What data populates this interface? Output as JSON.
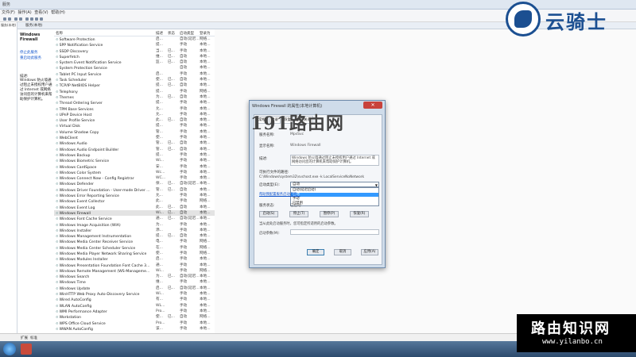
{
  "window": {
    "title": "服务"
  },
  "menu": [
    "文件(F)",
    "操作(A)",
    "查看(V)",
    "帮助(H)"
  ],
  "nav": [
    "服务(本地)"
  ],
  "header_tab": "服务(本地)",
  "desc": {
    "name": "Windows Firewall",
    "stop_link": "停止此服务",
    "restart_link": "重启动此服务",
    "label": "描述:",
    "text": "Windows 防火墙通过阻止未授权用户通过 Internet 或网络访问您的计算机来帮助保护计算机。"
  },
  "columns": {
    "name": "名称",
    "desc": "描述",
    "status": "状态",
    "startup": "启动类型",
    "logon": "登录为"
  },
  "services": [
    {
      "name": "Software Protection",
      "desc": "启...",
      "status": "",
      "startup": "自动(延迟...",
      "logon": "网络..."
    },
    {
      "name": "SPP Notification Service",
      "desc": "提...",
      "status": "",
      "startup": "手动",
      "logon": "本地..."
    },
    {
      "name": "SSDP Discovery",
      "desc": "当...",
      "status": "已...",
      "startup": "手动",
      "logon": "本地..."
    },
    {
      "name": "Superfetch",
      "desc": "维...",
      "status": "已...",
      "startup": "自动",
      "logon": "本地..."
    },
    {
      "name": "System Event Notification Service",
      "desc": "监...",
      "status": "已...",
      "startup": "自动",
      "logon": "本地..."
    },
    {
      "name": "System Protection Service",
      "desc": "",
      "status": "",
      "startup": "自动",
      "logon": "本地..."
    },
    {
      "name": "Tablet PC Input Service",
      "desc": "启...",
      "status": "",
      "startup": "手动",
      "logon": "本地..."
    },
    {
      "name": "Task Scheduler",
      "desc": "使...",
      "status": "已...",
      "startup": "自动",
      "logon": "本地..."
    },
    {
      "name": "TCP/IP NetBIOS Helper",
      "desc": "提...",
      "status": "已...",
      "startup": "自动",
      "logon": "本地..."
    },
    {
      "name": "Telephony",
      "desc": "提...",
      "status": "",
      "startup": "手动",
      "logon": "网络..."
    },
    {
      "name": "Themes",
      "desc": "为...",
      "status": "已...",
      "startup": "自动",
      "logon": "本地..."
    },
    {
      "name": "Thread Ordering Server",
      "desc": "提...",
      "status": "",
      "startup": "手动",
      "logon": "本地..."
    },
    {
      "name": "TPM Base Services",
      "desc": "允...",
      "status": "",
      "startup": "手动",
      "logon": "本地..."
    },
    {
      "name": "UPnP Device Host",
      "desc": "允...",
      "status": "",
      "startup": "手动",
      "logon": "本地..."
    },
    {
      "name": "User Profile Service",
      "desc": "此...",
      "status": "已...",
      "startup": "自动",
      "logon": "本地..."
    },
    {
      "name": "Virtual Disk",
      "desc": "提...",
      "status": "",
      "startup": "手动",
      "logon": "本地..."
    },
    {
      "name": "Volume Shadow Copy",
      "desc": "管...",
      "status": "",
      "startup": "手动",
      "logon": "本地..."
    },
    {
      "name": "WebClient",
      "desc": "使...",
      "status": "",
      "startup": "手动",
      "logon": "本地..."
    },
    {
      "name": "Windows Audio",
      "desc": "管...",
      "status": "已...",
      "startup": "自动",
      "logon": "本地..."
    },
    {
      "name": "Windows Audio Endpoint Builder",
      "desc": "管...",
      "status": "已...",
      "startup": "自动",
      "logon": "本地..."
    },
    {
      "name": "Windows Backup",
      "desc": "提...",
      "status": "",
      "startup": "手动",
      "logon": "本地..."
    },
    {
      "name": "Windows Biometric Service",
      "desc": "Wi...",
      "status": "",
      "startup": "手动",
      "logon": "本地..."
    },
    {
      "name": "Windows CardSpace",
      "desc": "安...",
      "status": "",
      "startup": "手动",
      "logon": "本地..."
    },
    {
      "name": "Windows Color System",
      "desc": "Wc...",
      "status": "",
      "startup": "手动",
      "logon": "本地..."
    },
    {
      "name": "Windows Connect Now - Config Registrar",
      "desc": "WC...",
      "status": "",
      "startup": "手动",
      "logon": "本地..."
    },
    {
      "name": "Windows Defender",
      "desc": "保...",
      "status": "已...",
      "startup": "自动(延迟...",
      "logon": "本地..."
    },
    {
      "name": "Windows Driver Foundation - User-mode Driver ...",
      "desc": "管...",
      "status": "已...",
      "startup": "自动",
      "logon": "本地..."
    },
    {
      "name": "Windows Error Reporting Service",
      "desc": "允...",
      "status": "",
      "startup": "手动",
      "logon": "本地..."
    },
    {
      "name": "Windows Event Collector",
      "desc": "此...",
      "status": "",
      "startup": "手动",
      "logon": "网络..."
    },
    {
      "name": "Windows Event Log",
      "desc": "此...",
      "status": "已...",
      "startup": "自动",
      "logon": "本地..."
    },
    {
      "name": "Windows Firewall",
      "desc": "Wi...",
      "status": "已...",
      "startup": "自动",
      "logon": "本地..."
    },
    {
      "name": "Windows Font Cache Service",
      "desc": "通...",
      "status": "已...",
      "startup": "自动(延迟...",
      "logon": "本地..."
    },
    {
      "name": "Windows Image Acquisition (WIA)",
      "desc": "为...",
      "status": "",
      "startup": "手动",
      "logon": "本地..."
    },
    {
      "name": "Windows Installer",
      "desc": "添...",
      "status": "",
      "startup": "手动",
      "logon": "本地..."
    },
    {
      "name": "Windows Management Instrumentation",
      "desc": "提...",
      "status": "已...",
      "startup": "自动",
      "logon": "本地..."
    },
    {
      "name": "Windows Media Center Receiver Service",
      "desc": "电...",
      "status": "",
      "startup": "手动",
      "logon": "网络..."
    },
    {
      "name": "Windows Media Center Scheduler Service",
      "desc": "在...",
      "status": "",
      "startup": "手动",
      "logon": "网络..."
    },
    {
      "name": "Windows Media Player Network Sharing Service",
      "desc": "使...",
      "status": "",
      "startup": "手动",
      "logon": "网络..."
    },
    {
      "name": "Windows Modules Installer",
      "desc": "启...",
      "status": "",
      "startup": "手动",
      "logon": "本地..."
    },
    {
      "name": "Windows Presentation Foundation Font Cache 3...",
      "desc": "通...",
      "status": "",
      "startup": "手动",
      "logon": "本地..."
    },
    {
      "name": "Windows Remote Management (WS-Manageme...",
      "desc": "Wi...",
      "status": "",
      "startup": "手动",
      "logon": "网络..."
    },
    {
      "name": "Windows Search",
      "desc": "为...",
      "status": "已...",
      "startup": "自动(延迟...",
      "logon": "本地..."
    },
    {
      "name": "Windows Time",
      "desc": "维...",
      "status": "",
      "startup": "手动",
      "logon": "本地..."
    },
    {
      "name": "Windows Update",
      "desc": "启...",
      "status": "已...",
      "startup": "自动(延迟...",
      "logon": "本地..."
    },
    {
      "name": "WinHTTP Web Proxy Auto-Discovery Service",
      "desc": "Wi...",
      "status": "",
      "startup": "手动",
      "logon": "本地..."
    },
    {
      "name": "Wired AutoConfig",
      "desc": "有...",
      "status": "",
      "startup": "手动",
      "logon": "本地..."
    },
    {
      "name": "WLAN AutoConfig",
      "desc": "WL...",
      "status": "",
      "startup": "手动",
      "logon": "本地..."
    },
    {
      "name": "WMI Performance Adapter",
      "desc": "Pro...",
      "status": "",
      "startup": "手动",
      "logon": "本地..."
    },
    {
      "name": "Workstation",
      "desc": "使...",
      "status": "已...",
      "startup": "自动",
      "logon": "网络..."
    },
    {
      "name": "WPS Office Cloud Service",
      "desc": "Pro...",
      "status": "",
      "startup": "手动",
      "logon": "本地..."
    },
    {
      "name": "WWAN AutoConfig",
      "desc": "该...",
      "status": "",
      "startup": "手动",
      "logon": "本地..."
    }
  ],
  "selected_index": 30,
  "statusbar": {
    "tab1": "扩展",
    "tab2": "标准"
  },
  "dialog": {
    "title": "Windows Firewall 的属性(本地计算机)",
    "tabs": [
      "常规",
      "登录",
      "恢复",
      "依存关系"
    ],
    "service_name_label": "服务名称:",
    "service_name": "MpsSvc",
    "display_name_label": "显示名称:",
    "display_name": "Windows Firewall",
    "desc_label": "描述:",
    "desc_text": "Windows 防火墙通过阻止未授权用户通过 Internet 或网络访问您的计算机来帮助保护计算机。",
    "path_label": "可执行文件的路径:",
    "path": "C:\\Windows\\system32\\svchost.exe -k LocalServiceNoNetwork",
    "startup_label": "启动类型(E):",
    "startup_value": "自动",
    "startup_options": [
      "自动(延迟启动)",
      "自动",
      "手动",
      "已禁用"
    ],
    "help_link": "帮助我配置服务启动选项。",
    "status_label": "服务状态:",
    "status_value": "已启动",
    "btn_start": "启动(S)",
    "btn_stop": "停止(T)",
    "btn_pause": "暂停(P)",
    "btn_resume": "恢复(R)",
    "hint": "当从此处启动服务时，您可指定所适用的启动参数。",
    "params_label": "启动参数(M):",
    "ok": "确定",
    "cancel": "取消",
    "apply": "应用(A)"
  },
  "watermarks": {
    "site1": "191路由网",
    "logo": "云骑士",
    "site2": "路由知识网",
    "site2_url": "www.yilanbo.cn"
  }
}
